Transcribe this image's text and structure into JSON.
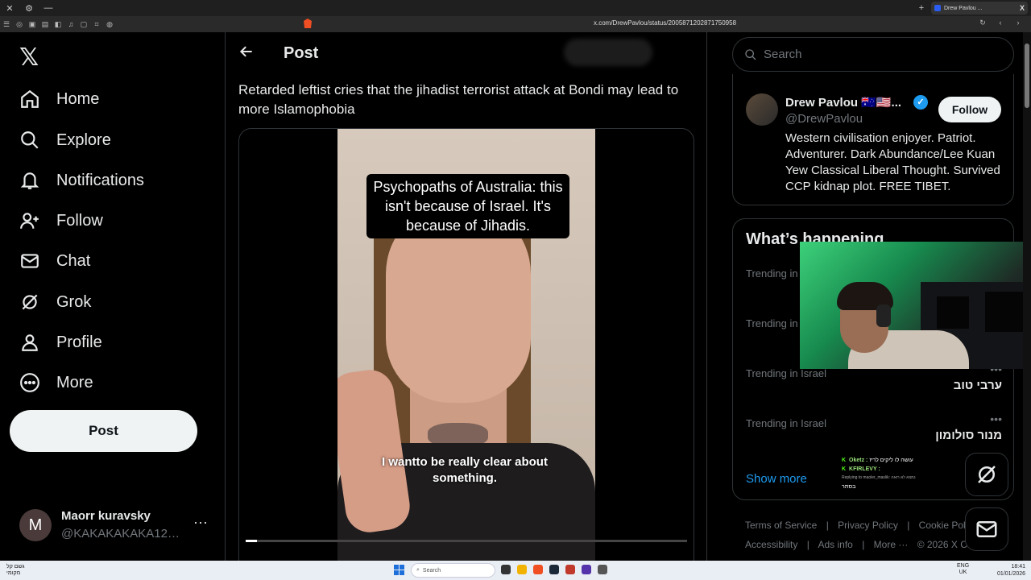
{
  "browser": {
    "tab_title": "Drew Pavlou ...",
    "tab_suffix": "X",
    "url": "x.com/DrewPavlou/status/2005871202871750958"
  },
  "nav": {
    "items": [
      {
        "label": "Home",
        "icon": "home-icon"
      },
      {
        "label": "Explore",
        "icon": "search-icon"
      },
      {
        "label": "Notifications",
        "icon": "bell-icon"
      },
      {
        "label": "Follow",
        "icon": "follow-icon"
      },
      {
        "label": "Chat",
        "icon": "mail-icon"
      },
      {
        "label": "Grok",
        "icon": "grok-icon"
      },
      {
        "label": "Profile",
        "icon": "person-icon"
      },
      {
        "label": "More",
        "icon": "more-circle-icon"
      }
    ],
    "post_button": "Post",
    "account": {
      "avatar_letter": "M",
      "name": "Maorr kuravsky",
      "handle": "@KAKAKAKAKA123...",
      "menu": "···"
    }
  },
  "main": {
    "header_title": "Post",
    "post_text": "Retarded leftist cries that the jihadist terrorist attack at Bondi may lead to more Islamophobia",
    "video": {
      "caption": "Psychopaths of Australia: this isn't because of Israel. It's because of Jihadis.",
      "subtitle": "I wantto be really clear about something.",
      "progress": 0.025
    }
  },
  "right": {
    "search_placeholder": "Search",
    "profile": {
      "name": "Drew Pavlou 🇦🇺🇺🇸...",
      "handle": "@DrewPavlou",
      "follow_label": "Follow",
      "bio": "Western civilisation enjoyer. Patriot. Adventurer. Dark Abundance/Lee Kuan Yew Classical Liberal Thought. Survived CCP kidnap plot. FREE TIBET."
    },
    "trends": {
      "title": "What’s happening",
      "items": [
        {
          "context": "Trending in",
          "topic": ""
        },
        {
          "context": "Trending in",
          "topic": ""
        },
        {
          "context": "Trending in Israel",
          "topic": "ערבי טוב"
        },
        {
          "context": "Trending in Israel",
          "topic": "מנור סולומון"
        }
      ],
      "show_more": "Show more"
    },
    "footer": [
      "Terms of Service",
      "|",
      "Privacy Policy",
      "|",
      "Cookie Policy",
      "|",
      "Accessibility",
      "|",
      "Ads info",
      "|",
      "More ···",
      "© 2026 X Corp."
    ]
  },
  "chat_overlay": {
    "messages": [
      {
        "badge": "K",
        "user": "Oketz :",
        "text": "עושה לו ליקים לריז"
      },
      {
        "badge": "K",
        "user": "KFIRLEVY :",
        "text": ""
      },
      {
        "badge": "",
        "user": "",
        "text": "Replying to maoler_maslik: נמצא לא רואה"
      },
      {
        "badge": "",
        "user": "",
        "text": "בסתר"
      }
    ]
  },
  "taskbar": {
    "weather": "גשם קל",
    "weather_sub": "מקומי",
    "search_placeholder": "Search",
    "lang": "ENG",
    "lang_sub": "UK",
    "time": "18:41",
    "date": "01/01/2026"
  },
  "colors": {
    "accent": "#1d9bf0",
    "background": "#000000",
    "border": "#2f3336",
    "muted": "#71767b"
  }
}
